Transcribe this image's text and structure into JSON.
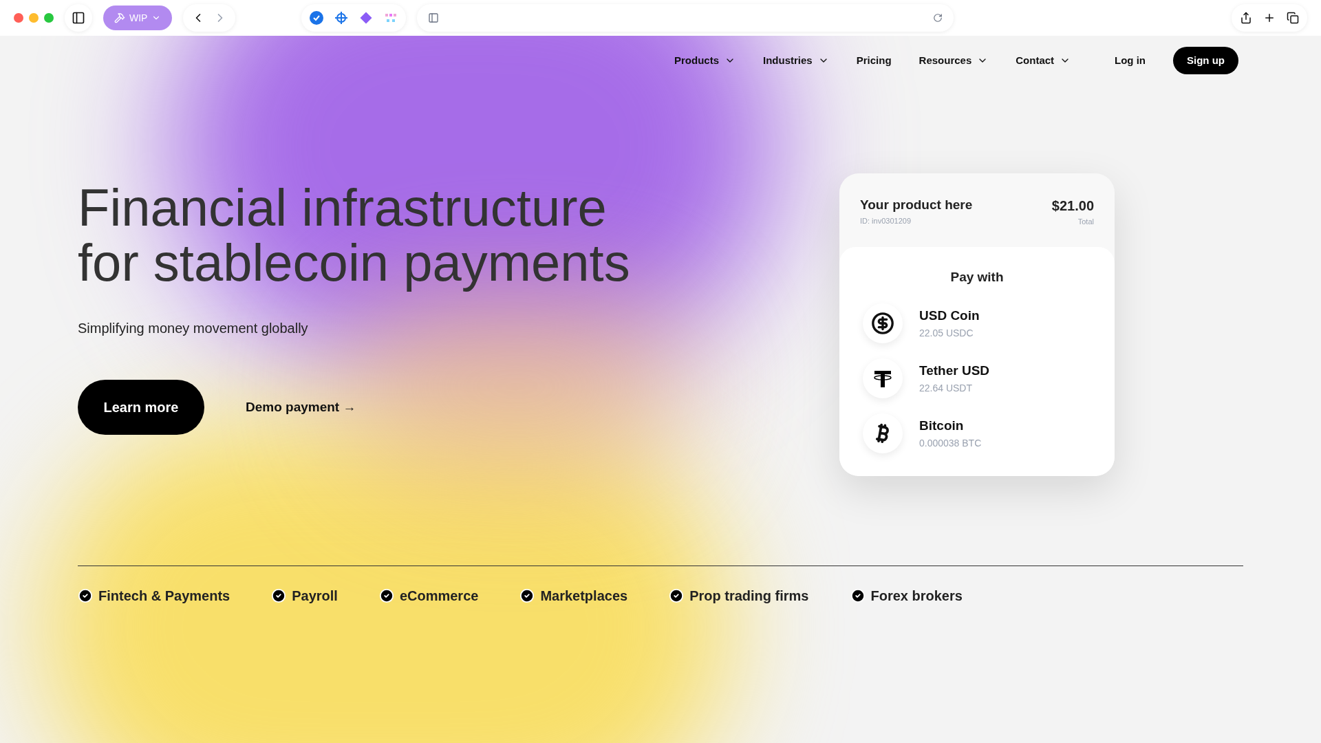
{
  "browser": {
    "tab_group": "WIP"
  },
  "nav": {
    "items": [
      {
        "label": "Products",
        "dropdown": true
      },
      {
        "label": "Industries",
        "dropdown": true
      },
      {
        "label": "Pricing",
        "dropdown": false
      },
      {
        "label": "Resources",
        "dropdown": true
      },
      {
        "label": "Contact",
        "dropdown": true
      }
    ],
    "login": "Log in",
    "signup": "Sign up"
  },
  "hero": {
    "title": "Financial infrastructure for stablecoin payments",
    "subtitle": "Simplifying money movement globally",
    "primary_button": "Learn more",
    "secondary_link": "Demo payment →"
  },
  "checkout_card": {
    "product": "Your product here",
    "id": "ID: inv0301209",
    "amount": "$21.00",
    "amount_label": "Total",
    "pay_with": "Pay with",
    "options": [
      {
        "kind": "usdc",
        "name": "USD Coin",
        "amount": "22.05 USDC"
      },
      {
        "kind": "usdt",
        "name": "Tether USD",
        "amount": "22.64 USDT"
      },
      {
        "kind": "btc",
        "name": "Bitcoin",
        "amount": "0.000038 BTC"
      }
    ]
  },
  "industries": [
    "Fintech & Payments",
    "Payroll",
    "eCommerce",
    "Marketplaces",
    "Prop trading firms",
    "Forex brokers"
  ]
}
